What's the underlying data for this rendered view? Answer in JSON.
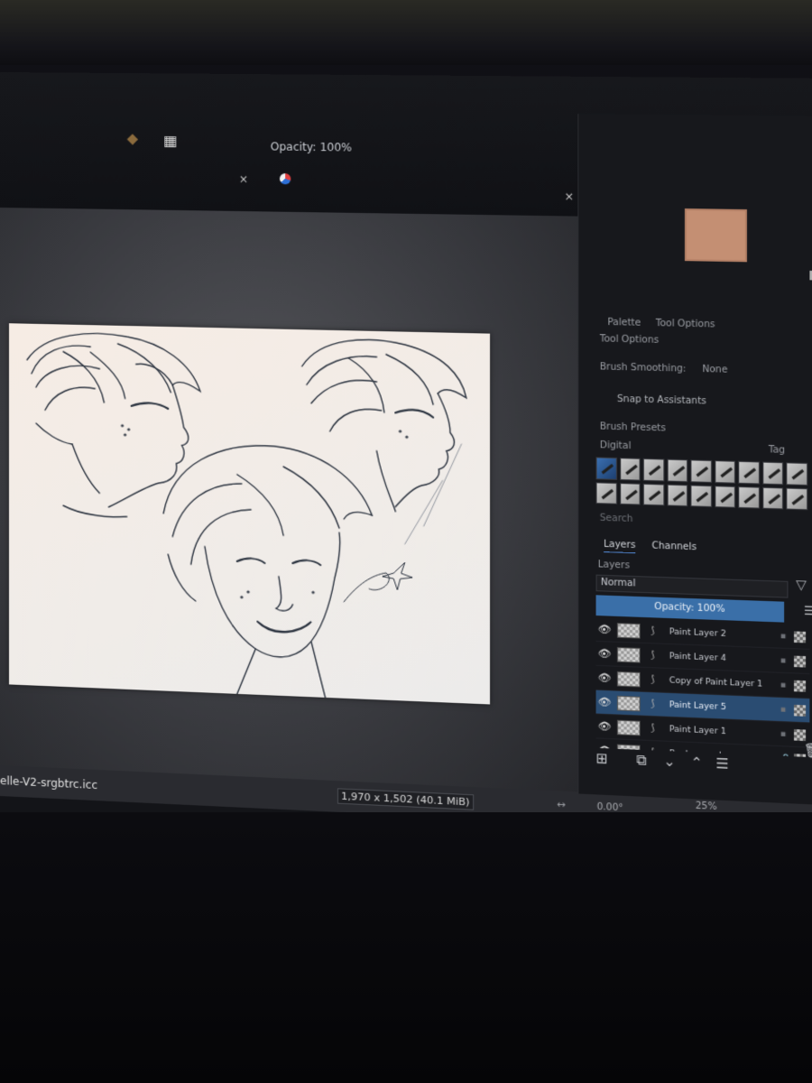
{
  "toolbar": {
    "opacity_label": "Opacity: 100%",
    "icons": [
      "brush-tip-icon",
      "pattern-icon",
      "color-selector-icon"
    ],
    "tab_close_glyph": "×"
  },
  "canvas": {
    "artwork_description_colors": {
      "paper": "#f3ece6",
      "ink": "#2c3440"
    }
  },
  "status_bar": {
    "color_profile": "elle-V2-srgbtrc.icc",
    "image_size": "1,970 x 1,502 (40.1 MiB)",
    "rotation": "0.00°",
    "zoom": "25%"
  },
  "docker": {
    "tabs": {
      "palette": "Palette",
      "tool_options": "Tool Options"
    },
    "tool_options_title": "Tool Options",
    "brush_smoothing_label": "Brush Smoothing:",
    "brush_smoothing_value": "None",
    "snap_to_assistants": "Snap to Assistants",
    "brush_presets_title": "Brush Presets",
    "brush_preset_tag": "Digital",
    "tag_label": "Tag",
    "search_placeholder": "Search",
    "layers_tabs": {
      "layers": "Layers",
      "channels": "Channels"
    },
    "layers_title": "Layers",
    "blend_mode": "Normal",
    "opacity": "Opacity:  100%",
    "layers": [
      {
        "name": "Paint Layer 2",
        "selected": false
      },
      {
        "name": "Paint Layer 4",
        "selected": false
      },
      {
        "name": "Copy of Paint Layer 1",
        "selected": false
      },
      {
        "name": "Paint Layer 5",
        "selected": true
      },
      {
        "name": "Paint Layer 1",
        "selected": false
      },
      {
        "name": "Background",
        "selected": false
      }
    ]
  },
  "colors": {
    "accent": "#3a6fa8",
    "selected_layer": "#2a4c72",
    "panel_bg": "#17181c"
  }
}
